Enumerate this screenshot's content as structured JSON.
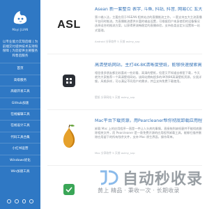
{
  "sidebar": {
    "site_name": "Mayi JLIAN",
    "intro": "以专业能力实现后端 | 为前端交付提供技术支持和保障 | 为您提供主要服务和售后服务",
    "nav": [
      {
        "label": "首页"
      },
      {
        "label": "高级服务"
      },
      {
        "label": "高级开发工具"
      },
      {
        "label": "Github加速"
      },
      {
        "label": "在线编辑工具"
      },
      {
        "label": "在线设计工具"
      },
      {
        "label": "代码工具合集"
      },
      {
        "label": "小红书运营"
      },
      {
        "label": "Windows优化"
      },
      {
        "label": "Win加速工具"
      }
    ],
    "social": [
      {
        "icon": "weibo-icon"
      },
      {
        "icon": "wechat-icon"
      },
      {
        "icon": "qq-icon"
      },
      {
        "icon": "github-icon"
      }
    ]
  },
  "posts": [
    {
      "title": "Asean 新一套整合 表字, 斗鱼, 抖站, 抖音, 网易CC 五大平台",
      "thumb_text": "ASL",
      "excerpt": "第二输入法，主要应用于ASEAN 相关站点的直播推流工作，一套支持五大主流直播平台同时推流。为直播推流提供丰富的输出设置，可根据用户本身使用的设备情况选择适合的推流方案，以获得更流畅稳定的直播体验，支持各类自定义设置和一站式管理。",
      "meta": "Android 分享软件 5 天前   aslmy_svp"
    },
    {
      "title": "高清壁纸网站，主打4K-8K清晰度壁纸，能够快速搜索高质量的图片资源",
      "thumb_text": "",
      "excerpt": "相信很多朋友都比较喜欢一些好看、高清的壁纸，但是又不知道去哪里下载，今天就为大家推荐一个高清壁纸网站，该网站拥有超多的4K到8K高清壁纸资源，分类详细，风格多样，可以满足不同用户的需求，并且支持免费下载使用。",
      "meta": "壁纸 分享网站 5 天前   aslmy_svp"
    },
    {
      "title": "Mac平台下载资源，用Pearcleaner帮你彻底卸载应用程序",
      "thumb_text": "",
      "excerpt": "卸载 Mac 上的应用程序一直是一件让人头疼的事情，直接拖到废纸篓并不能彻底删除相关文件，而 Pearcleaner 是一款免费开源的应用程序卸载工具，能够扫描并删除应用留下的所有残余文件，支持 Mac 原生界面，操作简单。",
      "meta": "Mac 分享软件 5 天前   aslmy_svp"
    },
    {
      "title": "",
      "thumb_text": "",
      "excerpt": "",
      "meta": ""
    }
  ],
  "watermark": {
    "brand": "自动秒收录",
    "tagline": "黄上 精品 · 秉收一次 · 长期收录"
  },
  "colors": {
    "sidebar": "#2f78c4",
    "title": "#3a76b8",
    "text": "#8a8f96"
  }
}
